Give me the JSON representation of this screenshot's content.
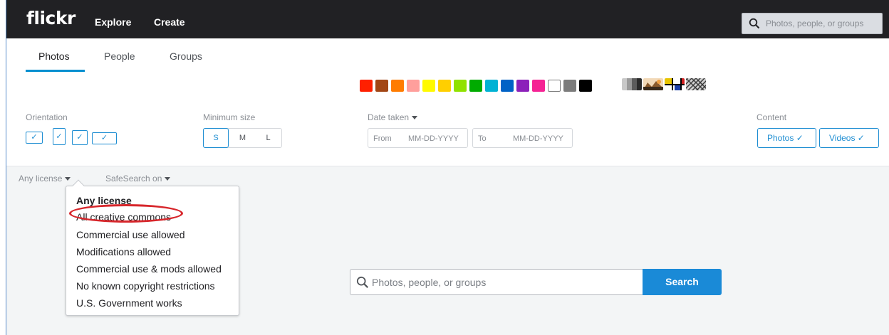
{
  "topbar": {
    "logo": "flickr",
    "nav": [
      "Explore",
      "Create"
    ],
    "search_placeholder": "Photos, people, or groups"
  },
  "tabs": [
    {
      "label": "Photos",
      "selected": true
    },
    {
      "label": "People",
      "selected": false
    },
    {
      "label": "Groups",
      "selected": false
    }
  ],
  "color_swatches": [
    "#ff2000",
    "#a24615",
    "#ff7c00",
    "#ff9f9c",
    "#fffa00",
    "#ffcf00",
    "#90e200",
    "#00ab00",
    "#00b2d4",
    "#0062c6",
    "#8c20ba",
    "#f52394",
    "#ffffff",
    "#7c7c7c",
    "#000000"
  ],
  "style_swatches": [
    "black-and-white",
    "shallow-depth-of-field",
    "minimalist",
    "patterns"
  ],
  "filters": {
    "orientation": {
      "label": "Orientation"
    },
    "min_size": {
      "label": "Minimum size",
      "options": [
        "S",
        "M",
        "L"
      ],
      "selected": "S"
    },
    "date_taken": {
      "label": "Date taken",
      "from_label": "From",
      "from_placeholder": "MM-DD-YYYY",
      "to_label": "To",
      "to_placeholder": "MM-DD-YYYY"
    },
    "content": {
      "label": "Content",
      "photos": "Photos ✓",
      "videos": "Videos ✓"
    }
  },
  "license": {
    "label": "Any license",
    "safesearch": "SafeSearch on",
    "options": [
      "Any license",
      "All creative commons",
      "Commercial use allowed",
      "Modifications allowed",
      "Commercial use & mods allowed",
      "No known copyright restrictions",
      "U.S. Government works"
    ]
  },
  "main_search": {
    "placeholder": "Photos, people, or groups",
    "button": "Search"
  }
}
